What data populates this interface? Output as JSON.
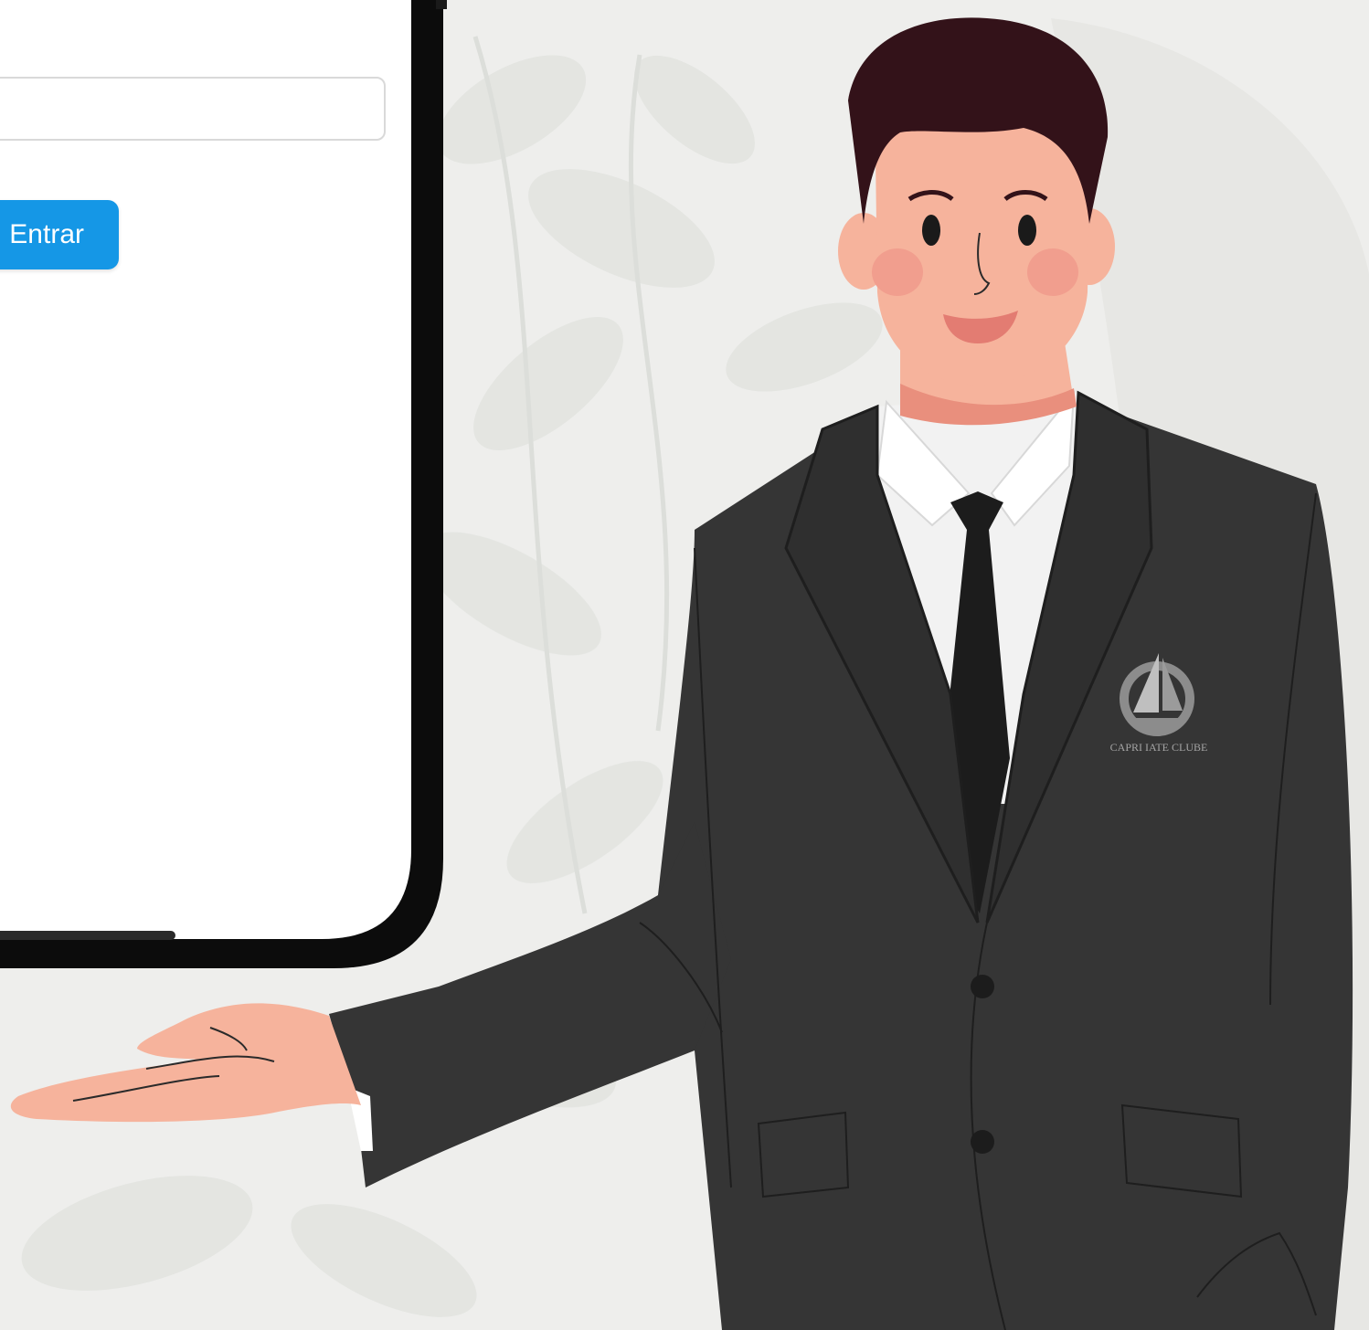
{
  "login": {
    "input_value": "",
    "input_placeholder": "",
    "button_label": "Entrar"
  },
  "jacket_logo": {
    "text": "CAPRI IATE CLUBE"
  },
  "colors": {
    "button": "#1597e6",
    "phone_frame": "#0c0c0c",
    "screen": "#ffffff",
    "suit": "#353535",
    "hair": "#331219",
    "skin": "#f6b39c",
    "background": "#eeeeec"
  }
}
